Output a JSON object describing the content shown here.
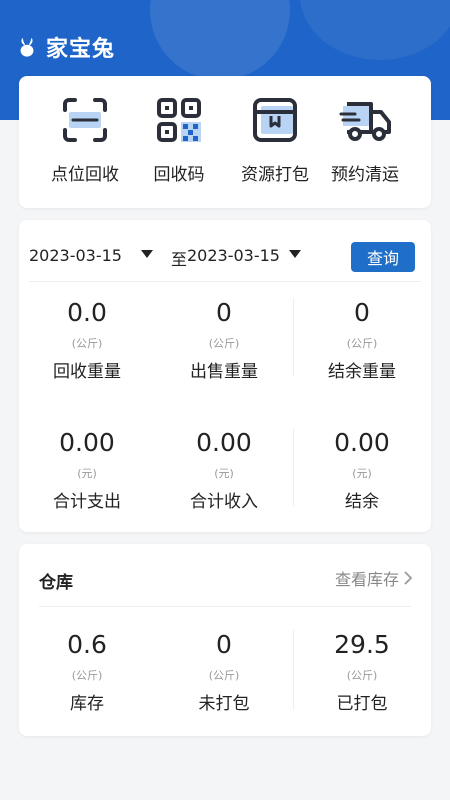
{
  "app": {
    "title": "家宝兔"
  },
  "actions": [
    {
      "label": "点位回收",
      "icon": "scan-frame-icon"
    },
    {
      "label": "回收码",
      "icon": "qr-code-icon"
    },
    {
      "label": "资源打包",
      "icon": "package-box-icon"
    },
    {
      "label": "预约清运",
      "icon": "delivery-truck-icon"
    }
  ],
  "filter": {
    "start_date": "2023-03-15",
    "to_label": "至",
    "end_date": "2023-03-15",
    "query_label": "查询"
  },
  "weights": [
    {
      "value": "0.0",
      "unit": "(公斤)",
      "label": "回收重量"
    },
    {
      "value": "0",
      "unit": "(公斤)",
      "label": "出售重量"
    },
    {
      "value": "0",
      "unit": "(公斤)",
      "label": "结余重量"
    }
  ],
  "money": [
    {
      "value": "0.00",
      "unit": "(元)",
      "label": "合计支出"
    },
    {
      "value": "0.00",
      "unit": "(元)",
      "label": "合计收入"
    },
    {
      "value": "0.00",
      "unit": "(元)",
      "label": "结余"
    }
  ],
  "warehouse": {
    "title": "仓库",
    "link_label": "查看库存",
    "items": [
      {
        "value": "0.6",
        "unit": "(公斤)",
        "label": "库存"
      },
      {
        "value": "0",
        "unit": "(公斤)",
        "label": "未打包"
      },
      {
        "value": "29.5",
        "unit": "(公斤)",
        "label": "已打包"
      }
    ]
  },
  "colors": {
    "brand": "#1f64c8",
    "button": "#1f6fc9",
    "icon_accent": "#b8d3f3"
  }
}
